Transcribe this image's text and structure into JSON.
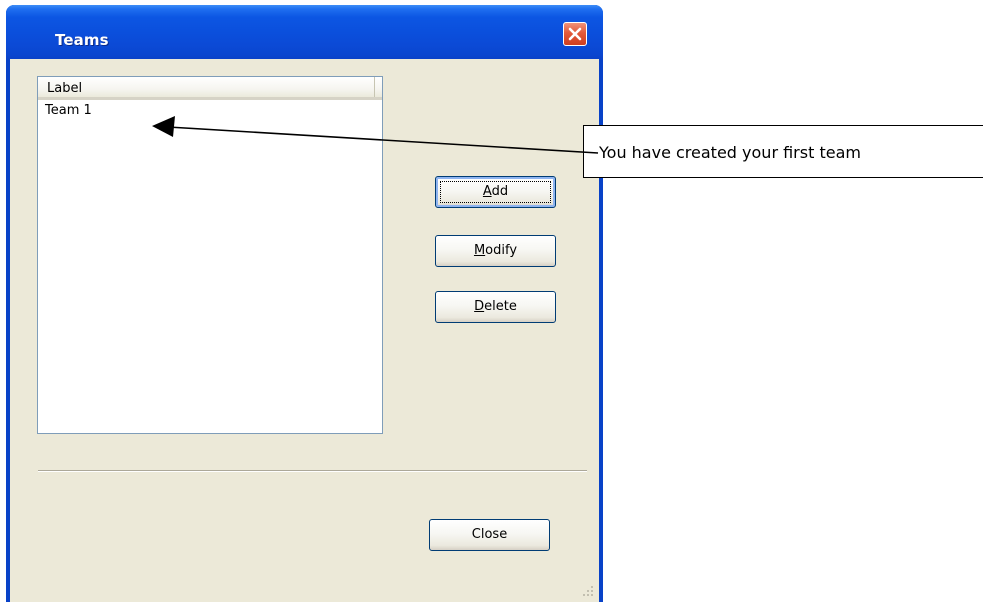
{
  "window": {
    "title": "Teams"
  },
  "list": {
    "column_header": "Label",
    "rows": [
      "Team 1"
    ]
  },
  "buttons": {
    "add": {
      "mnemonic": "A",
      "rest": "dd"
    },
    "modify": {
      "mnemonic": "M",
      "rest": "odify"
    },
    "delete": {
      "mnemonic": "D",
      "rest": "elete"
    },
    "close": "Close"
  },
  "callout": {
    "text": "You have created your first team"
  },
  "icons": {
    "close": "close-icon",
    "grip": "resize-grip-icon"
  },
  "colors": {
    "titlebar": "#0b4fdc",
    "close_button": "#e2593a",
    "dialog_background": "#ece9d8",
    "button_border": "#003c74"
  }
}
